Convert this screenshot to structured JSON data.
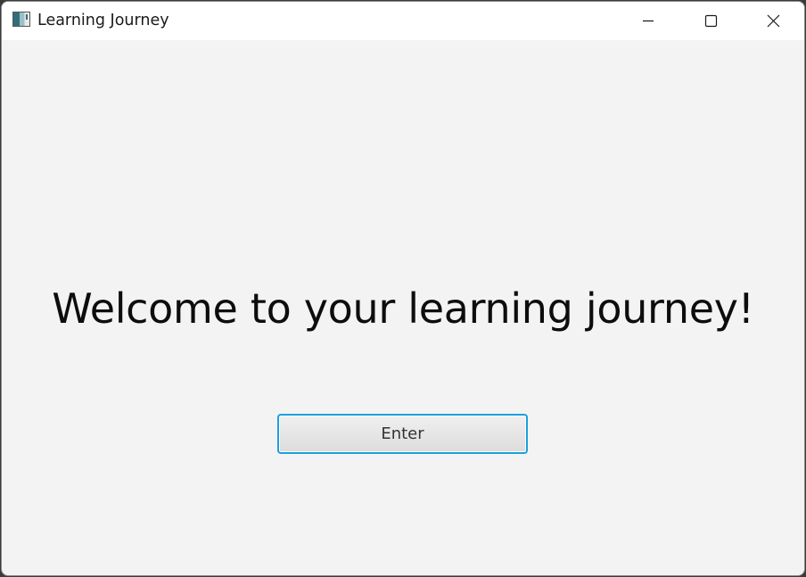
{
  "window": {
    "title": "Learning Journey",
    "icon": "app-window-icon",
    "controls": {
      "minimize": "minimize-icon",
      "maximize": "maximize-icon",
      "close": "close-icon"
    }
  },
  "main": {
    "welcome_text": "Welcome to your learning journey!",
    "enter_label": "Enter"
  },
  "colors": {
    "background": "#f3f3f3",
    "titlebar": "#ffffff",
    "button_focus_border": "#1aa0dc"
  }
}
